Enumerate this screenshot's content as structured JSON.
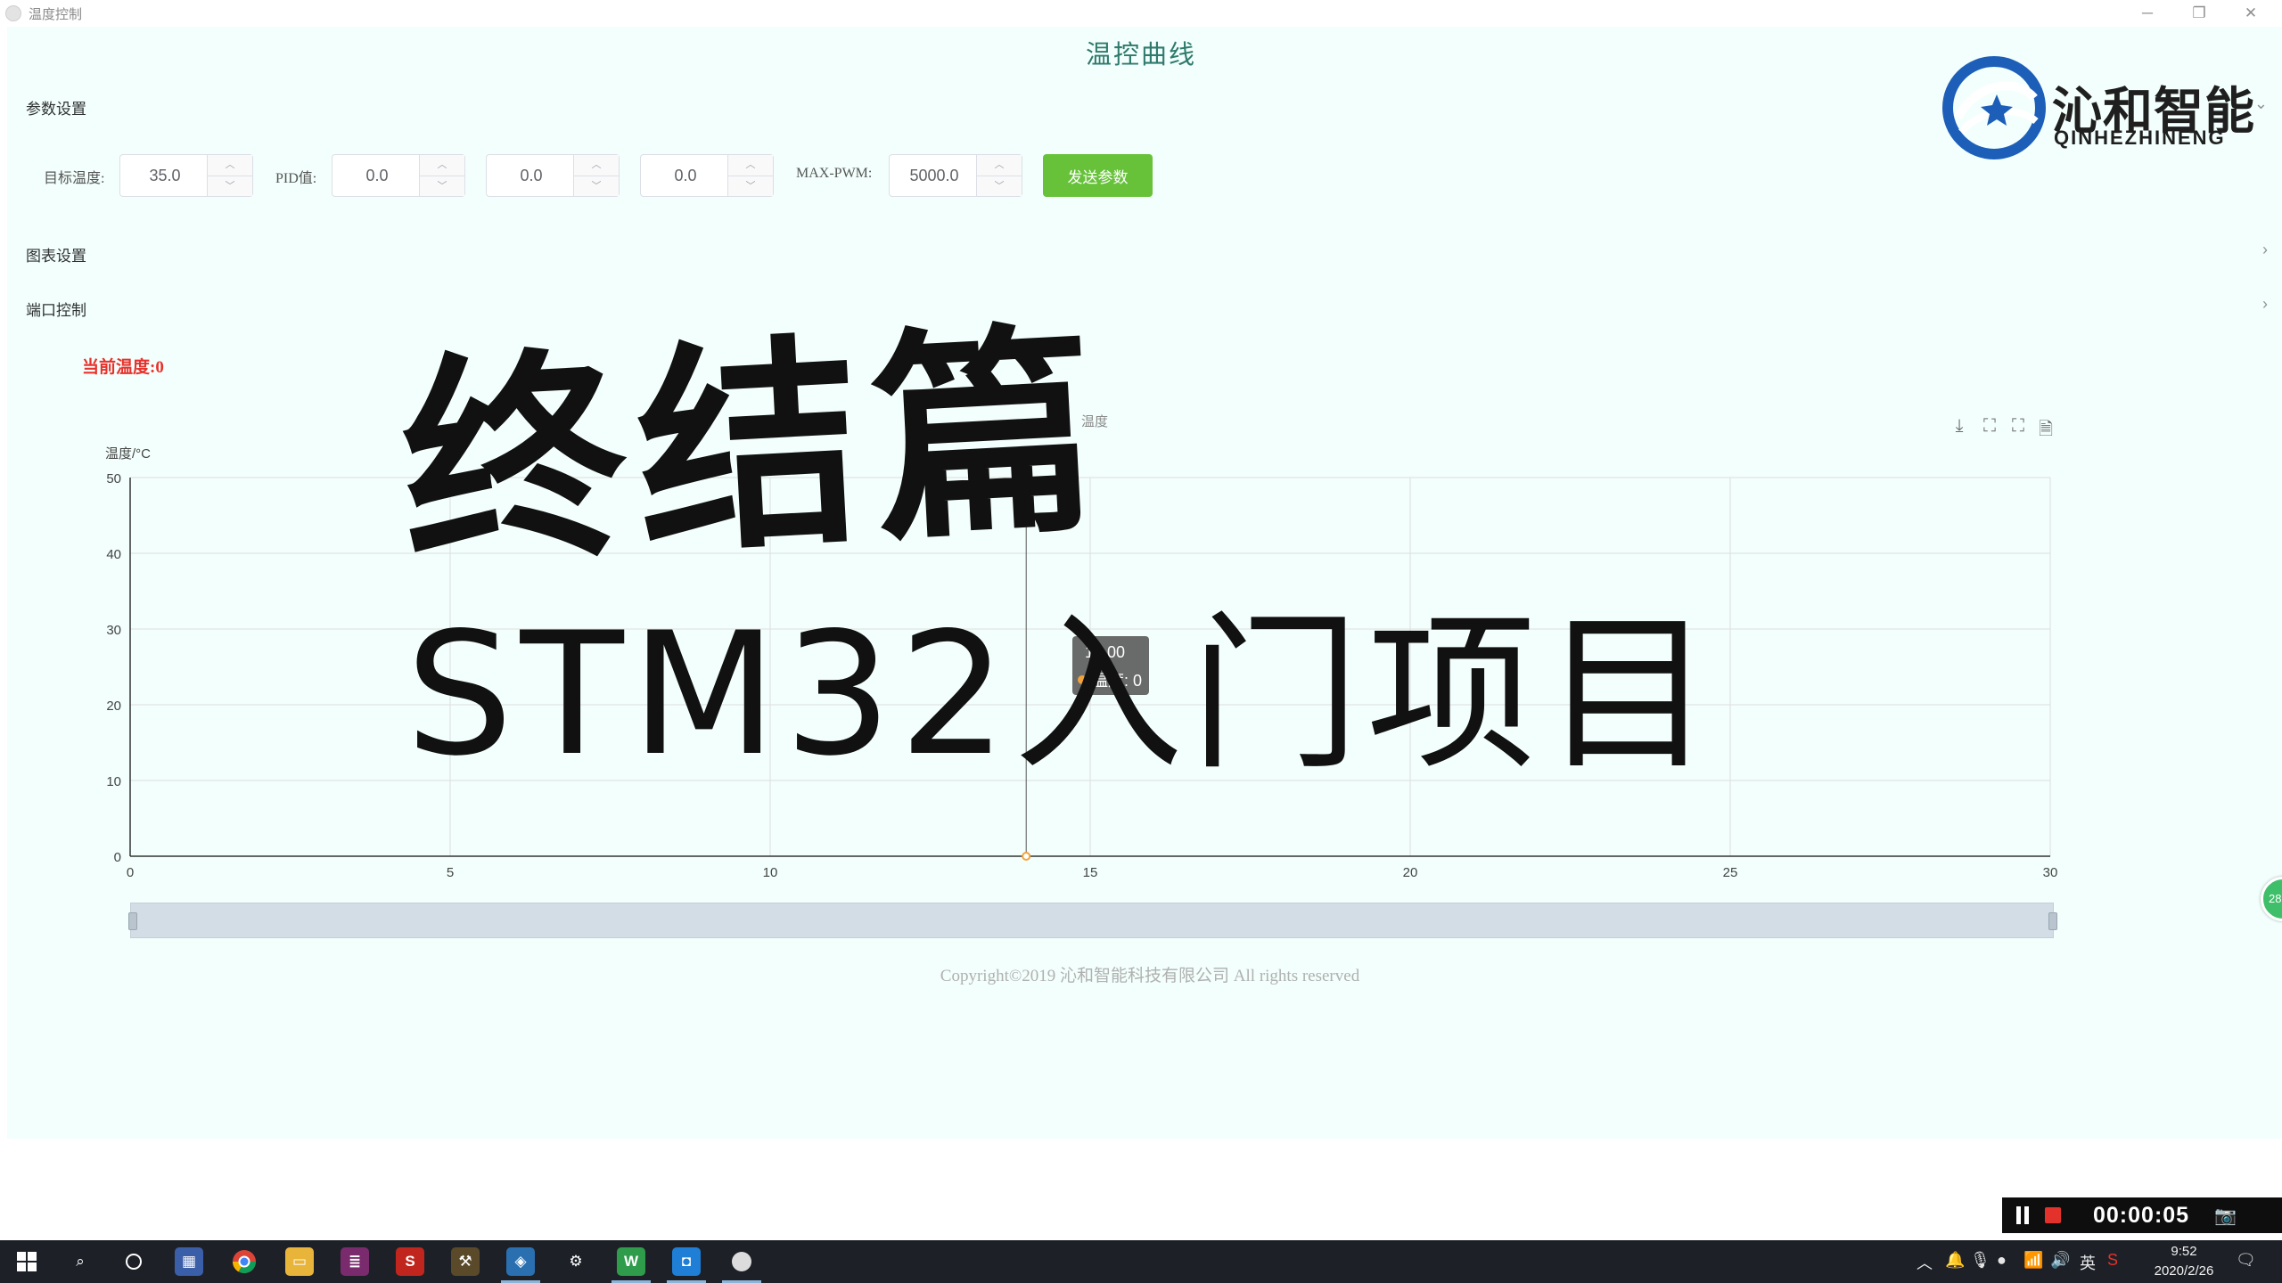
{
  "window": {
    "title": "温度控制",
    "minimize_icon": "minimize-icon",
    "restore_icon": "restore-icon",
    "close_icon": "close-icon"
  },
  "page": {
    "title": "温控曲线"
  },
  "sections": {
    "params": "参数设置",
    "chart_settings": "图表设置",
    "port_control": "端口控制"
  },
  "params": {
    "target_temp_label": "目标温度:",
    "target_temp_value": "35.0",
    "pid_label": "PID值:",
    "pid_p": "0.0",
    "pid_i": "0.0",
    "pid_d": "0.0",
    "max_pwm_label": "MAX-PWM:",
    "max_pwm_value": "5000.0",
    "send_button": "发送参数"
  },
  "status": {
    "current_temp": "当前温度:0"
  },
  "logo": {
    "name_cn": "沁和智能",
    "name_en": "QINHEZHINENG"
  },
  "chart_data": {
    "type": "line",
    "title": "温度",
    "ylabel": "温度/°C",
    "xlabel": "",
    "x_ticks": [
      0,
      5,
      10,
      15,
      20,
      25,
      30
    ],
    "y_ticks": [
      0,
      10,
      20,
      30,
      40,
      50
    ],
    "xlim": [
      0,
      30
    ],
    "ylim": [
      0,
      50
    ],
    "grid": true,
    "series": [
      {
        "name": "温度",
        "x": [
          14.0
        ],
        "y": [
          0
        ]
      }
    ],
    "tooltip": {
      "x_label": "14.00",
      "series_line": "温度: 0"
    },
    "cursor_x": 14.0,
    "toolbox": [
      "download-icon",
      "zoom-icon",
      "zoom-reset-icon",
      "data-view-icon"
    ]
  },
  "footer": {
    "copyright": "Copyright©2019 沁和智能科技有限公司 All rights reserved"
  },
  "overlay": {
    "heading": "终结篇",
    "subheading": "STM32入门项目"
  },
  "side_bubble": "28",
  "recorder": {
    "timer": "00:00:05"
  },
  "taskbar": {
    "time": "9:52",
    "date": "2020/2/26",
    "ime": "英"
  },
  "colors": {
    "app_background": "#f2fffc",
    "title_color": "#2e7a6c",
    "send_button": "#67c23a",
    "current_temp": "#e8322c",
    "logo_blue": "#1d5fb8"
  }
}
